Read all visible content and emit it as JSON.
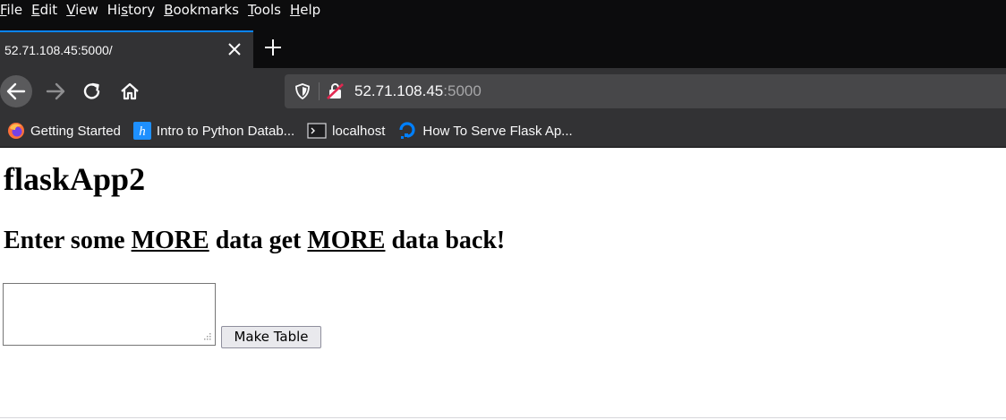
{
  "menu": {
    "items": [
      {
        "first": "F",
        "rest": "ile"
      },
      {
        "first": "E",
        "rest": "dit"
      },
      {
        "first": "V",
        "rest": "iew"
      },
      {
        "pre": "Hi",
        "first": "s",
        "rest": "tory"
      },
      {
        "first": "B",
        "rest": "ookmarks"
      },
      {
        "first": "T",
        "rest": "ools"
      },
      {
        "first": "H",
        "rest": "elp"
      }
    ]
  },
  "tab": {
    "title": "52.71.108.45:5000/"
  },
  "url": {
    "host": "52.71.108.45",
    "port": ":5000"
  },
  "bookmarks": [
    {
      "label": "Getting Started",
      "icon": "firefox-icon"
    },
    {
      "label": "Intro to Python Datab...",
      "icon": "h-icon"
    },
    {
      "label": "localhost",
      "icon": "terminal-icon"
    },
    {
      "label": "How To Serve Flask Ap...",
      "icon": "digitalocean-icon"
    }
  ],
  "page": {
    "title": "flaskApp2",
    "subtitle": {
      "part1": "Enter some ",
      "em1": "MORE",
      "part2": " data get ",
      "em2": "MORE",
      "part3": " data back!"
    },
    "textarea_value": "",
    "button_label": "Make Table"
  },
  "colors": {
    "chrome_dark": "#0c0c0d",
    "toolbar": "#323234",
    "accent": "#0a84ff",
    "urlbar": "#474749"
  }
}
